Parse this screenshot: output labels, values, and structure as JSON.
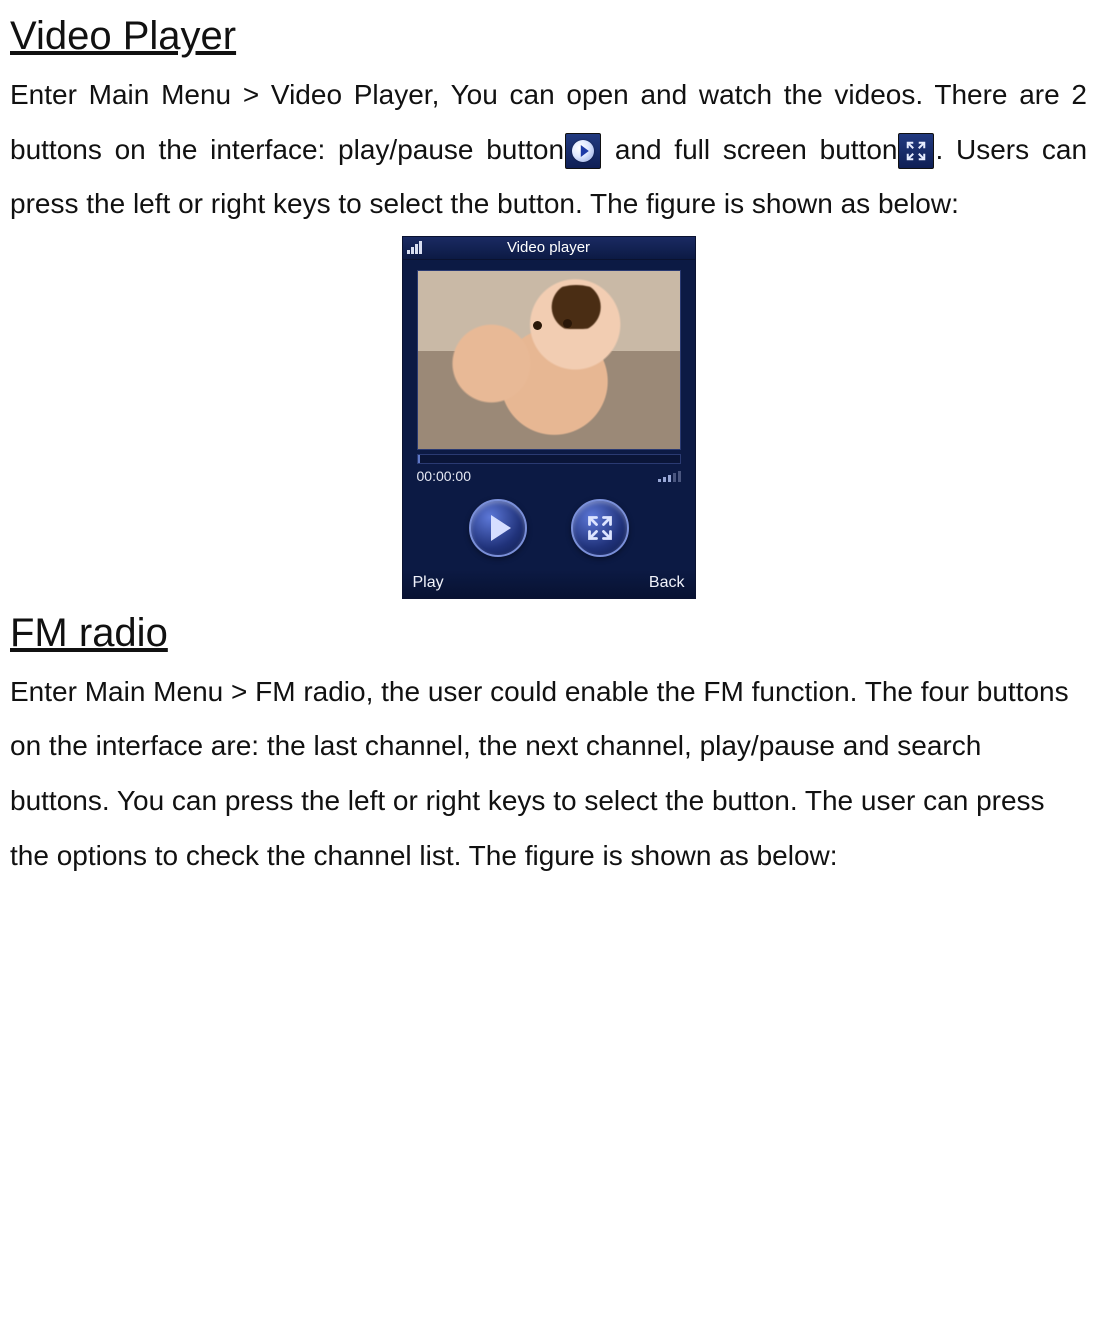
{
  "section1": {
    "heading": "Video Player",
    "p1a": "Enter  Main  Menu  >  Video  Player,  You  can  open  and  watch  the ",
    "p1b": "videos. There are 2 buttons on the interface: play/pause button",
    "p1c": " and full screen button",
    "p1d": ". Users can press the left or right keys to ",
    "p1e": "select the button. The figure is shown as below:"
  },
  "phone": {
    "title": "Video player",
    "time": "00:00:00",
    "soft_left": "Play",
    "soft_right": "Back"
  },
  "section2": {
    "heading": "FM radio",
    "body": "Enter Main Menu > FM radio, the user could enable the FM function. The four buttons on the interface are: the last channel, the next channel, play/pause and search buttons. You can press the left or right keys to select the button. The user can press the options to check the channel list. The figure is shown as below:"
  }
}
